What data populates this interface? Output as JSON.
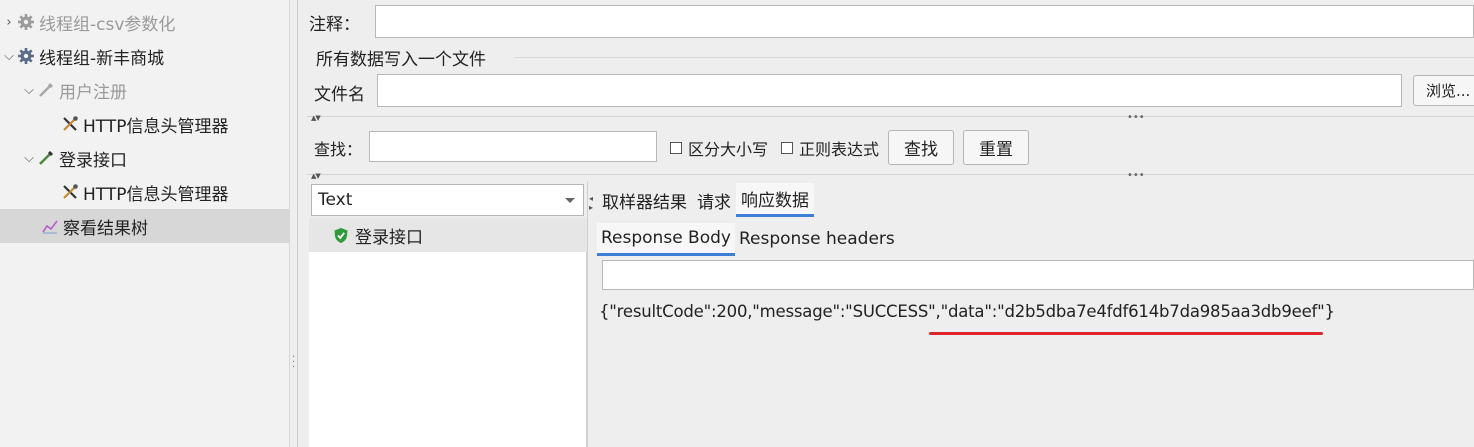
{
  "tree": {
    "items": [
      {
        "label": "线程组-csv参数化",
        "expander": "›",
        "icon": "gear-icon",
        "disabled": true
      },
      {
        "label": "线程组-新丰商城",
        "expander": "⌄",
        "icon": "gear-icon",
        "disabled": false
      },
      {
        "label": "用户注册",
        "expander": "⌄",
        "icon": "pipette-icon",
        "disabled": true
      },
      {
        "label": "HTTP信息头管理器",
        "expander": "",
        "icon": "tools-icon",
        "disabled": false
      },
      {
        "label": "登录接口",
        "expander": "⌄",
        "icon": "pipette-icon",
        "disabled": false
      },
      {
        "label": "HTTP信息头管理器",
        "expander": "",
        "icon": "tools-icon",
        "disabled": false
      },
      {
        "label": "察看结果树",
        "expander": "",
        "icon": "chart-icon",
        "disabled": false,
        "selected": true
      }
    ]
  },
  "form": {
    "comment_label": "注释：",
    "comment_value": "",
    "write_all_label": "所有数据写入一个文件",
    "filename_label": "文件名",
    "filename_value": "",
    "browse_button": "浏览..."
  },
  "search": {
    "label": "查找：",
    "value": "",
    "case_sensitive": "区分大小写",
    "regex": "正则表达式",
    "find_button": "查找",
    "reset_button": "重置"
  },
  "renderer": {
    "selected": "Text"
  },
  "results": [
    {
      "label": "登录接口",
      "status": "success"
    }
  ],
  "tabs": [
    "取样器结果",
    "请求",
    "响应数据"
  ],
  "active_tab": "响应数据",
  "subtabs": [
    "Response Body",
    "Response headers"
  ],
  "response": {
    "part1": "{\"resultCode\":200,\"message\":\"SUCCESS\"",
    "part2": ",\"data\":\"d2b5dba7e4fdf614b7da985aa3db9eef\"",
    "part3": "}"
  },
  "colors": {
    "accent": "#3d7fd6",
    "highlight_underline": "#e0242e",
    "success": "#2e9a3a"
  }
}
